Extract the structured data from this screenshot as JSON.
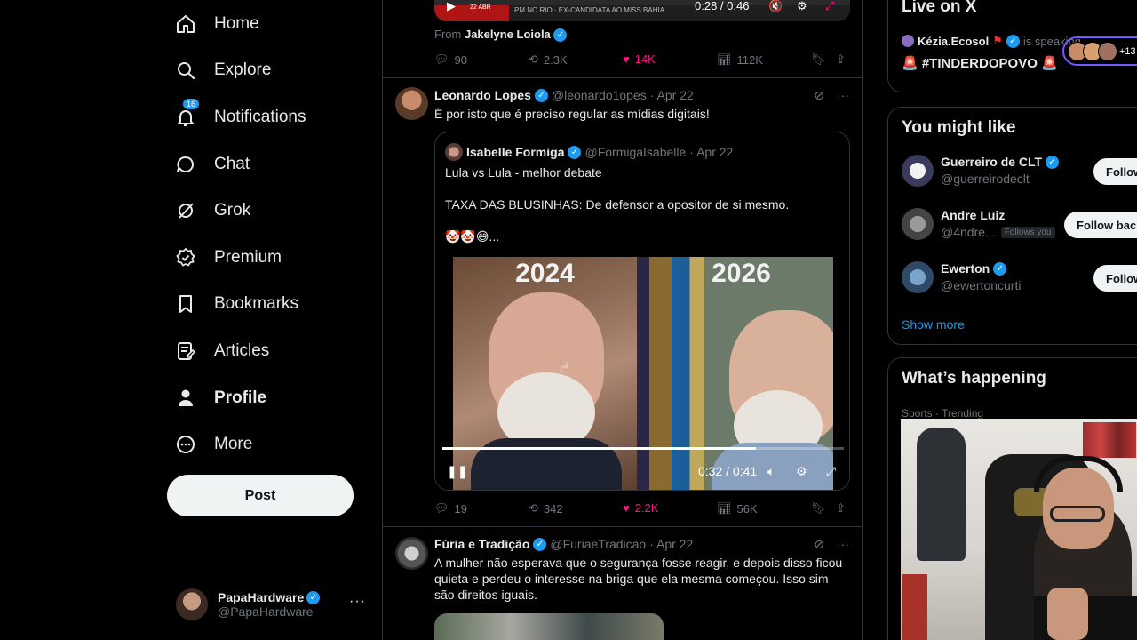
{
  "nav": {
    "items": [
      {
        "label": "Home",
        "icon": "home-icon"
      },
      {
        "label": "Explore",
        "icon": "search-icon"
      },
      {
        "label": "Notifications",
        "icon": "bell-icon",
        "badge": "16"
      },
      {
        "label": "Chat",
        "icon": "chat-bubble-icon"
      },
      {
        "label": "Grok",
        "icon": "grok-icon"
      },
      {
        "label": "Premium",
        "icon": "verified-badge-icon"
      },
      {
        "label": "Bookmarks",
        "icon": "bookmark-icon"
      },
      {
        "label": "Articles",
        "icon": "article-icon"
      },
      {
        "label": "Profile",
        "icon": "person-icon"
      },
      {
        "label": "More",
        "icon": "more-circle-icon"
      }
    ],
    "post_label": "Post",
    "account": {
      "name": "PapaHardware",
      "handle": "@PapaHardware"
    }
  },
  "feed": {
    "top_video": {
      "date_badge": "22 ABR",
      "ticker": "PM NO RIO · EX-CANDIDATA AO MISS BAHIA",
      "time": "0:28 / 0:46"
    },
    "top_from": {
      "prefix": "From",
      "name": "Jakelyne Loiola"
    },
    "top_stats": {
      "replies": "90",
      "reposts": "2.3K",
      "likes": "14K",
      "views": "112K"
    },
    "tweet1": {
      "name": "Leonardo Lopes",
      "handle": "@leonardo1opes",
      "date": "· Apr 22",
      "text": "É por isto que é preciso regular as mídias digitais!",
      "quote": {
        "name": "Isabelle Formiga",
        "handle": "@FormigaIsabelle",
        "date": "· Apr 22",
        "line1": "Lula vs Lula - melhor debate",
        "line2": "TAXA DAS BLUSINHAS: De defensor a opositor de si mesmo.",
        "line3": "🤡🤡😅...",
        "video": {
          "label_left": "2024",
          "label_right": "2026",
          "time": "0:32 / 0:41",
          "progress": 0.78
        }
      },
      "stats": {
        "replies": "19",
        "reposts": "342",
        "likes": "2.2K",
        "views": "56K"
      }
    },
    "tweet2": {
      "name": "Fúria e Tradição",
      "handle": "@FuriaeTradicao",
      "date": "· Apr 22",
      "text": "A mulher não esperava que o segurança fosse reagir, e depois disso ficou quieta e perdeu o interesse na briga que ela mesma começou. Isso sim são direitos iguais."
    }
  },
  "right": {
    "live": {
      "title": "Live on X",
      "host": "Kézia.Ecosol",
      "host_status": "is speaking",
      "space_title": "🚨 #TINDERDOPOVO 🚨",
      "listeners_more": "+13"
    },
    "might_like": {
      "title": "You might like",
      "users": [
        {
          "name": "Guerreiro de CLT",
          "handle": "@guerreirodeclt",
          "verified": true,
          "button": "Follow",
          "follows_you": ""
        },
        {
          "name": "Andre Luiz",
          "handle": "@4ndre...",
          "verified": false,
          "button": "Follow back",
          "follows_you": "Follows you"
        },
        {
          "name": "Ewerton",
          "handle": "@ewertoncurti",
          "verified": true,
          "button": "Follow",
          "follows_you": ""
        }
      ],
      "show_more": "Show more"
    },
    "happening": {
      "title": "What’s happening",
      "trend_meta": "Sports · Trending"
    }
  },
  "colors": {
    "accent": "#1d9bf0",
    "like": "#f91880",
    "text": "#e7e9ea",
    "muted": "#71767b",
    "border": "#2f3336"
  }
}
